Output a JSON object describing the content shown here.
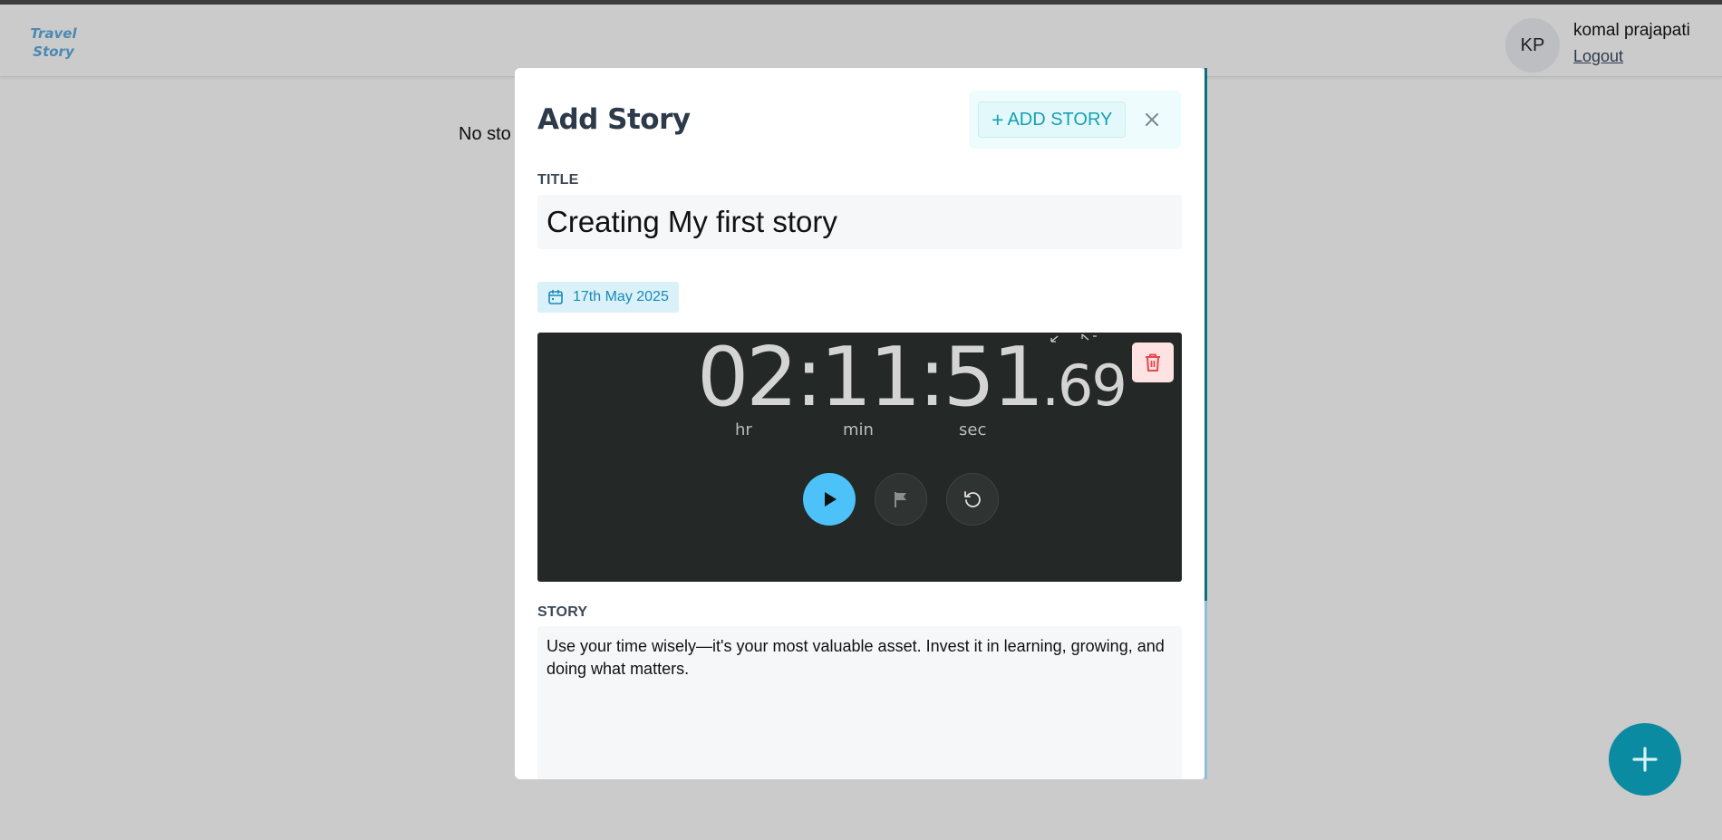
{
  "app": {
    "logo_line1": "Travel",
    "logo_line2": "Story"
  },
  "user": {
    "initials": "KP",
    "name": "komal prajapati",
    "logout_label": "Logout"
  },
  "page": {
    "empty_text_visible": "No sto"
  },
  "modal": {
    "title": "Add Story",
    "add_button_label": "ADD STORY",
    "title_label": "TITLE",
    "title_value": "Creating My first story",
    "date": "17th May 2025",
    "story_label": "STORY",
    "story_value": "Use your time wisely—it's your most valuable asset. Invest it in learning, growing, and doing what matters."
  },
  "media": {
    "timer_main": "02:11:51",
    "timer_fraction": ".69",
    "label_hr": "hr",
    "label_min": "min",
    "label_sec": "sec"
  },
  "colors": {
    "accent": "#0a8ba1",
    "play": "#4cc2f8",
    "delete_bg": "#ffe2e2",
    "delete_icon": "#e5484d"
  },
  "icons": {
    "close": "close-icon",
    "calendar": "calendar-icon",
    "delete": "trash-icon",
    "play": "play-icon",
    "flag": "flag-icon",
    "reset": "reset-icon",
    "fab": "plus-icon"
  }
}
